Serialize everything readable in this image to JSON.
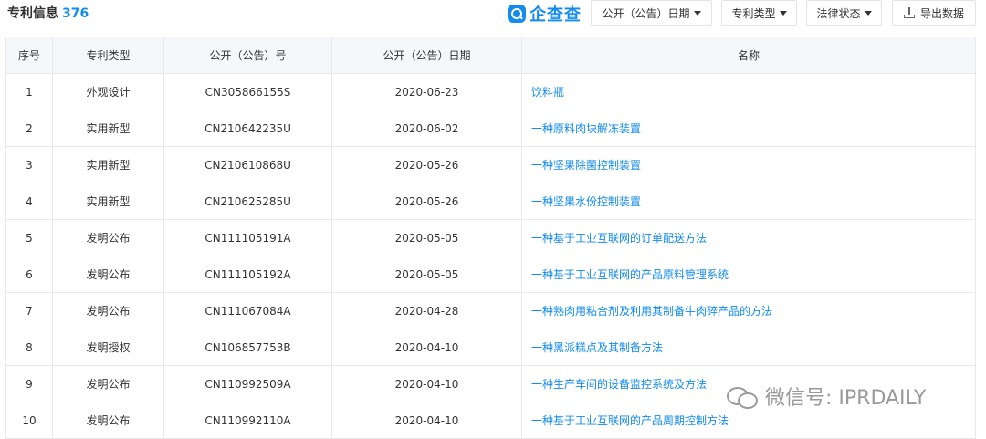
{
  "header": {
    "title": "专利信息",
    "count": "376",
    "logo_text": "企查查"
  },
  "filters": [
    {
      "label": "公开（公告）日期"
    },
    {
      "label": "专利类型"
    },
    {
      "label": "法律状态"
    }
  ],
  "export_label": "导出数据",
  "table": {
    "columns": [
      "序号",
      "专利类型",
      "公开（公告）号",
      "公开（公告）日期",
      "名称"
    ],
    "rows": [
      {
        "no": "1",
        "type": "外观设计",
        "number": "CN305866155S",
        "date": "2020-06-23",
        "name": "饮料瓶"
      },
      {
        "no": "2",
        "type": "实用新型",
        "number": "CN210642235U",
        "date": "2020-06-02",
        "name": "一种原料肉块解冻装置"
      },
      {
        "no": "3",
        "type": "实用新型",
        "number": "CN210610868U",
        "date": "2020-05-26",
        "name": "一种坚果除菌控制装置"
      },
      {
        "no": "4",
        "type": "实用新型",
        "number": "CN210625285U",
        "date": "2020-05-26",
        "name": "一种坚果水份控制装置"
      },
      {
        "no": "5",
        "type": "发明公布",
        "number": "CN111105191A",
        "date": "2020-05-05",
        "name": "一种基于工业互联网的订单配送方法"
      },
      {
        "no": "6",
        "type": "发明公布",
        "number": "CN111105192A",
        "date": "2020-05-05",
        "name": "一种基于工业互联网的产品原料管理系统"
      },
      {
        "no": "7",
        "type": "发明公布",
        "number": "CN111067084A",
        "date": "2020-04-28",
        "name": "一种熟肉用粘合剂及利用其制备牛肉碎产品的方法"
      },
      {
        "no": "8",
        "type": "发明授权",
        "number": "CN106857753B",
        "date": "2020-04-10",
        "name": "一种黑派糕点及其制备方法"
      },
      {
        "no": "9",
        "type": "发明公布",
        "number": "CN110992509A",
        "date": "2020-04-10",
        "name": "一种生产车间的设备监控系统及方法"
      },
      {
        "no": "10",
        "type": "发明公布",
        "number": "CN110992110A",
        "date": "2020-04-10",
        "name": "一种基于工业互联网的产品周期控制方法"
      }
    ]
  },
  "watermark": "微信号: IPRDAILY"
}
